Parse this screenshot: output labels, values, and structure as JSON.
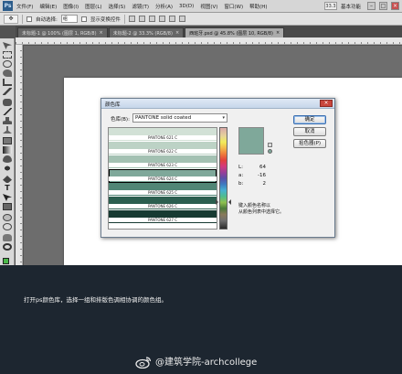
{
  "menubar": {
    "logo": "Ps",
    "items": [
      "文件(F)",
      "编辑(E)",
      "图像(I)",
      "图层(L)",
      "选择(S)",
      "滤镜(T)",
      "分析(A)",
      "3D(D)",
      "视图(V)",
      "窗口(W)",
      "帮助(H)"
    ],
    "zoom": "33.3",
    "workspace": "基本功能"
  },
  "options": {
    "auto_select_label": "自动选择:",
    "auto_select_value": "组",
    "show_transform_label": "显示变换控件"
  },
  "tabs": [
    {
      "label": "未标题-1 @ 100% (图层 1, RGB/8)",
      "active": false
    },
    {
      "label": "未标题-2 @ 33.3% (RGB/8)",
      "active": false
    },
    {
      "label": "西班牙.psd @ 45.8% (图层 10, RGB/8)",
      "active": true
    }
  ],
  "dialog": {
    "title": "颜色库",
    "book_label": "色库(B):",
    "book_value": "PANTONE solid coated",
    "swatches": [
      {
        "name": "PANTONE 621 C",
        "color": "#d2e1d6",
        "selected": false
      },
      {
        "name": "PANTONE 622 C",
        "color": "#bcd2c5",
        "selected": false
      },
      {
        "name": "PANTONE 623 C",
        "color": "#a3c1b2",
        "selected": false
      },
      {
        "name": "PANTONE 624 C",
        "color": "#7fa89a",
        "selected": true
      },
      {
        "name": "PANTONE 625 C",
        "color": "#518676",
        "selected": false
      },
      {
        "name": "PANTONE 626 C",
        "color": "#2b5e4f",
        "selected": false
      },
      {
        "name": "PANTONE 627 C",
        "color": "#173a32",
        "selected": false
      }
    ],
    "preview_color": "#7fa89a",
    "lab": {
      "L": "64",
      "a": "-16",
      "b": "2"
    },
    "hint": "键入颜色名称以\n从颜色列表中选择它。",
    "buttons": {
      "ok": "确定",
      "cancel": "取消",
      "picker": "拾色器(P)"
    }
  },
  "caption": "打开ps颜色库，选择一组和排版色调相协调的颜色组。",
  "watermark": "@建筑学院-archcollege"
}
